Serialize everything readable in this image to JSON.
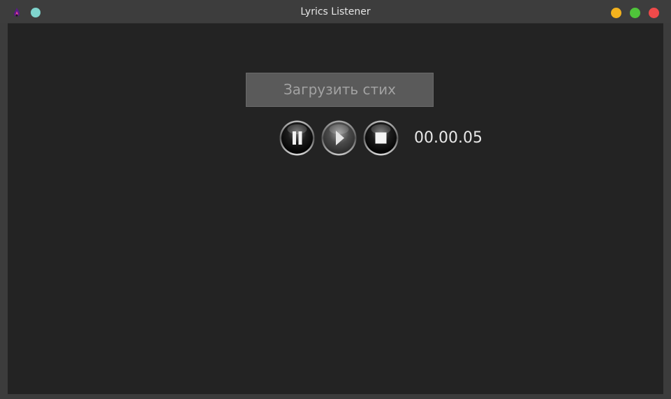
{
  "window": {
    "title": "Lyrics Listener",
    "icons": {
      "app": "flame-app-icon",
      "pin": "pin-dot-icon",
      "minimize": "minimize-dot-icon",
      "maximize": "maximize-dot-icon",
      "close": "close-dot-icon"
    },
    "colors": {
      "minimize": "#f3b21e",
      "maximize": "#4fc43a",
      "close": "#ef4a4a",
      "pin": "#7fd4cd"
    }
  },
  "main": {
    "load_button_label": "Загрузить стих",
    "controls": {
      "pause_icon": "pause-icon",
      "play_icon": "play-icon",
      "stop_icon": "stop-icon"
    },
    "timer": "00.00.05"
  }
}
